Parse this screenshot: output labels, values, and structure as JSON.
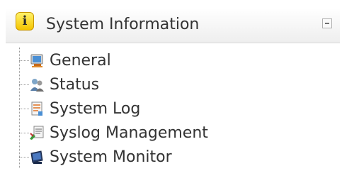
{
  "panel": {
    "title": "System Information",
    "header_icon": "info-icon",
    "collapse_icon": "minus-icon"
  },
  "items": [
    {
      "label": "General",
      "icon": "monitor-icon"
    },
    {
      "label": "Status",
      "icon": "users-status-icon"
    },
    {
      "label": "System Log",
      "icon": "document-log-icon"
    },
    {
      "label": "Syslog Management",
      "icon": "syslog-icon"
    },
    {
      "label": "System Monitor",
      "icon": "system-monitor-icon"
    }
  ],
  "colors": {
    "accent": "#f4c400",
    "text": "#333333"
  }
}
